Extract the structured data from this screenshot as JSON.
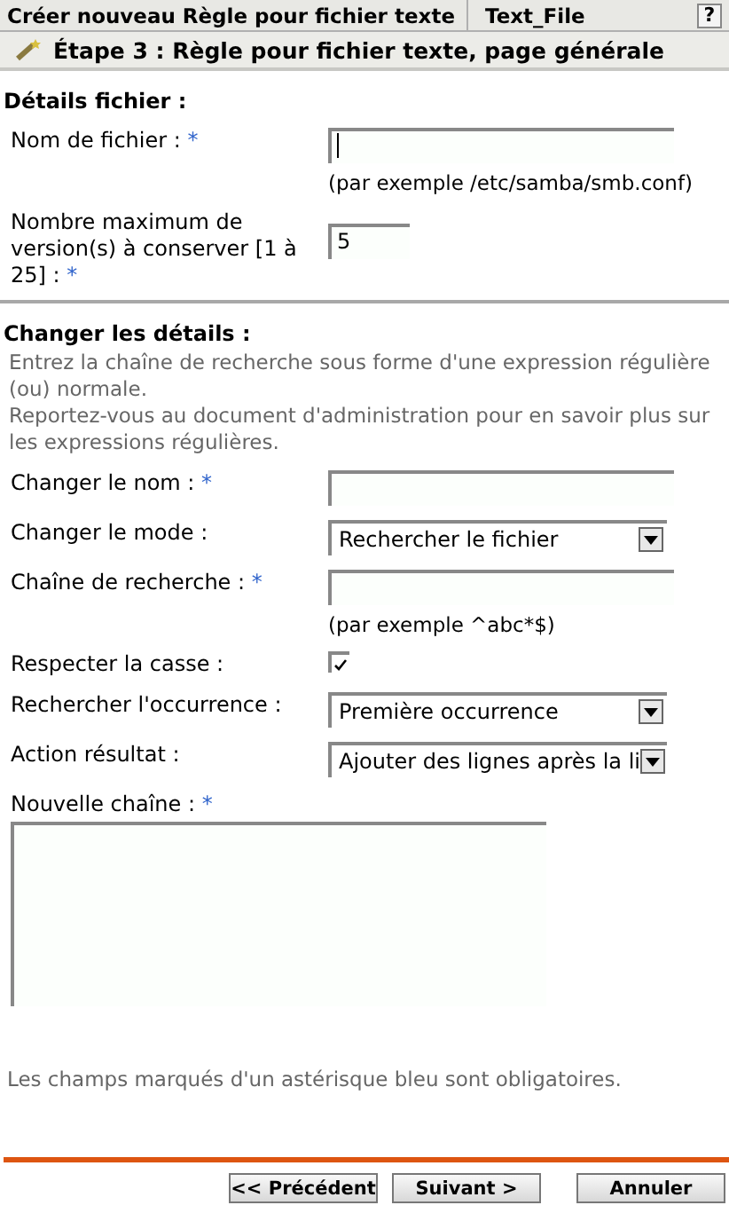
{
  "header": {
    "title": "Créer nouveau Règle pour fichier texte",
    "object": "Text_File",
    "help": "?"
  },
  "step": {
    "title": "Étape 3 : Règle pour fichier texte, page générale"
  },
  "sections": [
    {
      "title": "Détails fichier :",
      "fields": [
        {
          "kind": "text",
          "label": "Nom de fichier :",
          "mark": "*",
          "hint": "(par exemple /etc/samba/smb.conf)",
          "focused": true
        },
        {
          "kind": "short",
          "label": "Nombre maximum de version(s) à conserver [1 à 25] :",
          "mark": "*",
          "value": "5"
        }
      ]
    },
    {
      "title": "Changer les détails :",
      "description": [
        "Entrez la chaîne de recherche sous forme d'une expression régulière (ou) normale.",
        "Reportez-vous au document d'administration pour en savoir plus sur les expressions régulières."
      ],
      "fields": [
        {
          "kind": "text",
          "label": "Changer le nom :",
          "mark": "*"
        },
        {
          "kind": "select",
          "label": "Changer le mode :",
          "value": "Rechercher le fichier"
        },
        {
          "kind": "text",
          "label": "Chaîne de recherche :",
          "mark": "*",
          "hint": "(par exemple ^abc*$)"
        },
        {
          "kind": "checkbox",
          "label": "Respecter la casse :",
          "checked": true
        },
        {
          "kind": "select",
          "label": "Rechercher l'occurrence :",
          "value": "Première occurrence"
        },
        {
          "kind": "select",
          "label": "Action résultat :",
          "value": "Ajouter des lignes après la li"
        },
        {
          "kind": "textarea",
          "label": "Nouvelle chaîne :",
          "mark": "*"
        }
      ]
    }
  ],
  "note": "Les champs marqués d'un astérisque bleu sont obligatoires.",
  "buttons": [
    "<< Précédent",
    "Suivant >",
    "Annuler"
  ]
}
